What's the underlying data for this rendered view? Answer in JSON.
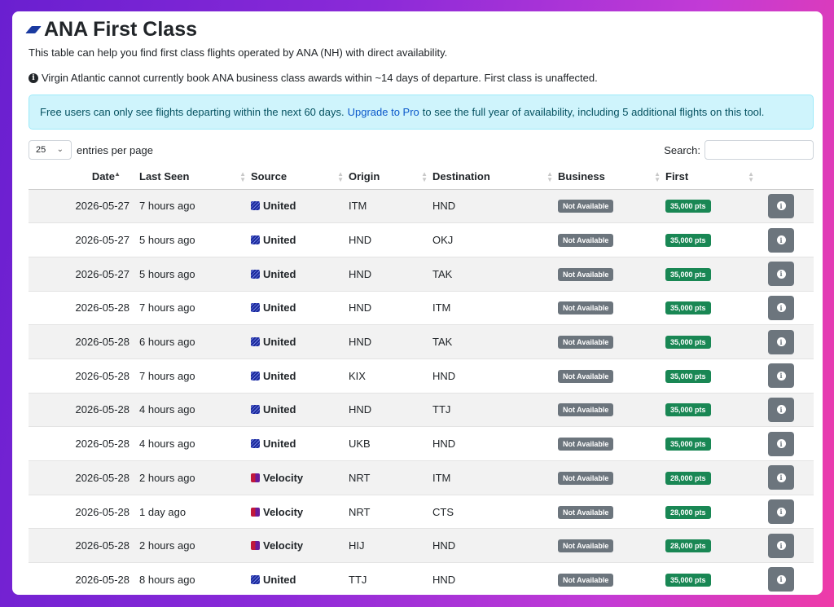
{
  "page": {
    "title": "ANA First Class",
    "description": "This table can help you find first class flights operated by ANA (NH) with direct availability.",
    "note": "Virgin Atlantic cannot currently book ANA business class awards within ~14 days of departure. First class is unaffected."
  },
  "alert": {
    "before": "Free users can only see flights departing within the next 60 days.",
    "link": "Upgrade to Pro",
    "after": "to see the full year of availability, including 5 additional flights on this tool."
  },
  "controls": {
    "page_size": "25",
    "entries_label": "entries per page",
    "search_label": "Search:",
    "search_value": ""
  },
  "columns": [
    "Date",
    "Last Seen",
    "Source",
    "Origin",
    "Destination",
    "Business",
    "First"
  ],
  "rows": [
    {
      "date": "2026-05-27",
      "seen": "7 hours ago",
      "source": "United",
      "source_icon": "united",
      "origin": "ITM",
      "dest": "HND",
      "business": "Not Available",
      "first": "35,000 pts"
    },
    {
      "date": "2026-05-27",
      "seen": "5 hours ago",
      "source": "United",
      "source_icon": "united",
      "origin": "HND",
      "dest": "OKJ",
      "business": "Not Available",
      "first": "35,000 pts"
    },
    {
      "date": "2026-05-27",
      "seen": "5 hours ago",
      "source": "United",
      "source_icon": "united",
      "origin": "HND",
      "dest": "TAK",
      "business": "Not Available",
      "first": "35,000 pts"
    },
    {
      "date": "2026-05-28",
      "seen": "7 hours ago",
      "source": "United",
      "source_icon": "united",
      "origin": "HND",
      "dest": "ITM",
      "business": "Not Available",
      "first": "35,000 pts"
    },
    {
      "date": "2026-05-28",
      "seen": "6 hours ago",
      "source": "United",
      "source_icon": "united",
      "origin": "HND",
      "dest": "TAK",
      "business": "Not Available",
      "first": "35,000 pts"
    },
    {
      "date": "2026-05-28",
      "seen": "7 hours ago",
      "source": "United",
      "source_icon": "united",
      "origin": "KIX",
      "dest": "HND",
      "business": "Not Available",
      "first": "35,000 pts"
    },
    {
      "date": "2026-05-28",
      "seen": "4 hours ago",
      "source": "United",
      "source_icon": "united",
      "origin": "HND",
      "dest": "TTJ",
      "business": "Not Available",
      "first": "35,000 pts"
    },
    {
      "date": "2026-05-28",
      "seen": "4 hours ago",
      "source": "United",
      "source_icon": "united",
      "origin": "UKB",
      "dest": "HND",
      "business": "Not Available",
      "first": "35,000 pts"
    },
    {
      "date": "2026-05-28",
      "seen": "2 hours ago",
      "source": "Velocity",
      "source_icon": "velocity",
      "origin": "NRT",
      "dest": "ITM",
      "business": "Not Available",
      "first": "28,000 pts"
    },
    {
      "date": "2026-05-28",
      "seen": "1 day ago",
      "source": "Velocity",
      "source_icon": "velocity",
      "origin": "NRT",
      "dest": "CTS",
      "business": "Not Available",
      "first": "28,000 pts"
    },
    {
      "date": "2026-05-28",
      "seen": "2 hours ago",
      "source": "Velocity",
      "source_icon": "velocity",
      "origin": "HIJ",
      "dest": "HND",
      "business": "Not Available",
      "first": "28,000 pts"
    },
    {
      "date": "2026-05-28",
      "seen": "8 hours ago",
      "source": "United",
      "source_icon": "united",
      "origin": "TTJ",
      "dest": "HND",
      "business": "Not Available",
      "first": "35,000 pts"
    }
  ]
}
